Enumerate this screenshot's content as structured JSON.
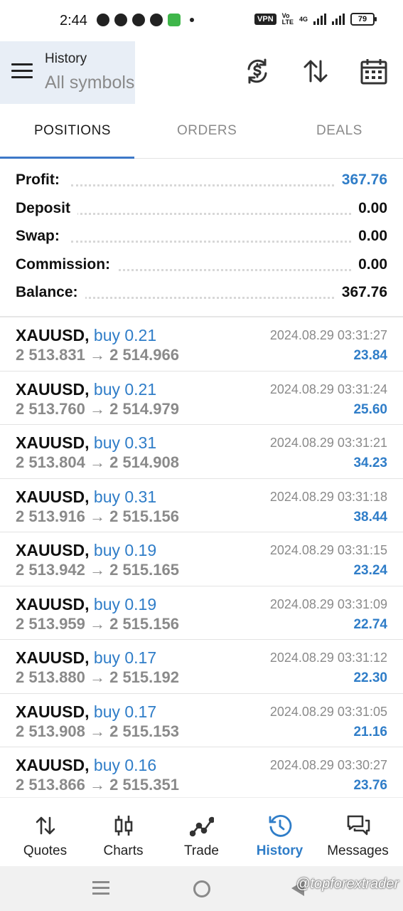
{
  "status_bar": {
    "time": "2:44",
    "vpn": "VPN",
    "network": "4G",
    "battery": "79"
  },
  "header": {
    "title": "History",
    "subtitle": "All symbols",
    "icons": [
      "menu-icon",
      "sync-currency-icon",
      "sort-icon",
      "calendar-icon"
    ]
  },
  "tabs": [
    {
      "label": "POSITIONS",
      "active": true
    },
    {
      "label": "ORDERS",
      "active": false
    },
    {
      "label": "DEALS",
      "active": false
    }
  ],
  "summary": [
    {
      "label": "Profit:",
      "value": "367.76",
      "highlight": true
    },
    {
      "label": "Deposit",
      "value": "0.00",
      "highlight": false
    },
    {
      "label": "Swap:",
      "value": "0.00",
      "highlight": false
    },
    {
      "label": "Commission:",
      "value": "0.00",
      "highlight": false
    },
    {
      "label": "Balance:",
      "value": "367.76",
      "highlight": false
    }
  ],
  "trades": [
    {
      "symbol": "XAUUSD,",
      "side": "buy 0.21",
      "prices": "2 513.831 → 2 514.966",
      "time": "2024.08.29 03:31:27",
      "profit": "23.84"
    },
    {
      "symbol": "XAUUSD,",
      "side": "buy 0.21",
      "prices": "2 513.760 → 2 514.979",
      "time": "2024.08.29 03:31:24",
      "profit": "25.60"
    },
    {
      "symbol": "XAUUSD,",
      "side": "buy 0.31",
      "prices": "2 513.804 → 2 514.908",
      "time": "2024.08.29 03:31:21",
      "profit": "34.23"
    },
    {
      "symbol": "XAUUSD,",
      "side": "buy 0.31",
      "prices": "2 513.916 → 2 515.156",
      "time": "2024.08.29 03:31:18",
      "profit": "38.44"
    },
    {
      "symbol": "XAUUSD,",
      "side": "buy 0.19",
      "prices": "2 513.942 → 2 515.165",
      "time": "2024.08.29 03:31:15",
      "profit": "23.24"
    },
    {
      "symbol": "XAUUSD,",
      "side": "buy 0.19",
      "prices": "2 513.959 → 2 515.156",
      "time": "2024.08.29 03:31:09",
      "profit": "22.74"
    },
    {
      "symbol": "XAUUSD,",
      "side": "buy 0.17",
      "prices": "2 513.880 → 2 515.192",
      "time": "2024.08.29 03:31:12",
      "profit": "22.30"
    },
    {
      "symbol": "XAUUSD,",
      "side": "buy 0.17",
      "prices": "2 513.908 → 2 515.153",
      "time": "2024.08.29 03:31:05",
      "profit": "21.16"
    },
    {
      "symbol": "XAUUSD,",
      "side": "buy 0.16",
      "prices": "2 513.866 → 2 515.351",
      "time": "2024.08.29 03:30:27",
      "profit": "23.76"
    }
  ],
  "bottom_nav": [
    {
      "label": "Quotes",
      "icon": "quotes-icon",
      "active": false
    },
    {
      "label": "Charts",
      "icon": "charts-icon",
      "active": false
    },
    {
      "label": "Trade",
      "icon": "trade-icon",
      "active": false
    },
    {
      "label": "History",
      "icon": "history-icon",
      "active": true
    },
    {
      "label": "Messages",
      "icon": "messages-icon",
      "active": false
    }
  ],
  "watermark": "@topforextrader",
  "colors": {
    "accent": "#2f7dc8",
    "header_bg": "#e8eef6",
    "muted_text": "#8a8a8a"
  }
}
